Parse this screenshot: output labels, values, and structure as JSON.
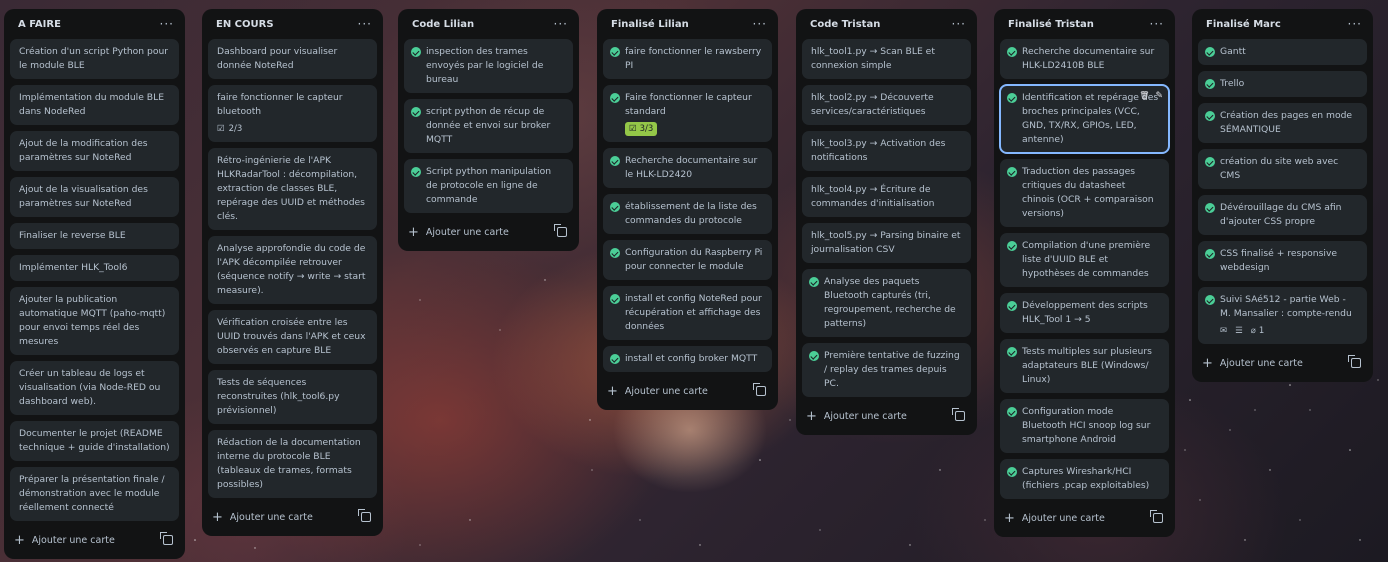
{
  "lists": [
    {
      "title": "A FAIRE",
      "add_label": "Ajouter une carte",
      "cards": [
        {
          "text": "Création d'un script Python pour le module BLE"
        },
        {
          "text": "Implémentation du module BLE dans NodeRed"
        },
        {
          "text": "Ajout de la modification des paramètres sur NoteRed"
        },
        {
          "text": "Ajout de la visualisation des paramètres sur NoteRed"
        },
        {
          "text": "Finaliser le reverse BLE"
        },
        {
          "text": "Implémenter HLK_Tool6"
        },
        {
          "text": "Ajouter la publication automatique MQTT (paho-mqtt) pour envoi temps réel des mesures"
        },
        {
          "text": "Créer un tableau de logs et visualisation (via Node-RED ou dashboard web)."
        },
        {
          "text": "Documenter le projet (README technique + guide d'installation)"
        },
        {
          "text": "Préparer la présentation finale / démonstration avec le module réellement connecté"
        }
      ]
    },
    {
      "title": "EN COURS",
      "add_label": "Ajouter une carte",
      "cards": [
        {
          "text": "Dashboard pour visualiser donnée NoteRed"
        },
        {
          "text": "faire fonctionner le capteur bluetooth",
          "checklist": "2/3"
        },
        {
          "text": "Rétro-ingénierie de l'APK HLKRadarTool : décompilation, extraction de classes BLE, repérage des UUID et méthodes clés."
        },
        {
          "text": "Analyse approfondie du code de l'APK décompilée retrouver (séquence notify → write → start measure)."
        },
        {
          "text": "Vérification croisée entre les UUID trouvés dans l'APK et ceux observés en capture BLE"
        },
        {
          "text": "Tests de séquences reconstruites (hlk_tool6.py prévisionnel)"
        },
        {
          "text": "Rédaction de la documentation interne du protocole BLE (tableaux de trames, formats possibles)"
        }
      ]
    },
    {
      "title": "Code Lilian",
      "add_label": "Ajouter une carte",
      "cards": [
        {
          "text": "inspection des trames envoyés par le logiciel de bureau",
          "done": true
        },
        {
          "text": "script python de récup de donnée et envoi sur broker MQTT",
          "done": true
        },
        {
          "text": "Script python manipulation de protocole en ligne de commande",
          "done": true
        }
      ]
    },
    {
      "title": "Finalisé Lilian",
      "add_label": "Ajouter une carte",
      "cards": [
        {
          "text": "faire fonctionner le rawsberry PI",
          "done": true
        },
        {
          "text": "Faire fonctionner le capteur standard",
          "done": true,
          "checklist_green": "3/3"
        },
        {
          "text": "Recherche documentaire sur le HLK-LD2420",
          "done": true
        },
        {
          "text": "établissement de la liste des commandes du protocole",
          "done": true
        },
        {
          "text": "Configuration du Raspberry Pi pour connecter le module",
          "done": true
        },
        {
          "text": "install et config NoteRed pour récupération et affichage des données",
          "done": true
        },
        {
          "text": "install et config broker MQTT",
          "done": true
        }
      ]
    },
    {
      "title": "Code Tristan",
      "add_label": "Ajouter une carte",
      "cards": [
        {
          "text": "hlk_tool1.py → Scan BLE et connexion simple"
        },
        {
          "text": "hlk_tool2.py → Découverte services/caractéristiques"
        },
        {
          "text": "hlk_tool3.py → Activation des notifications"
        },
        {
          "text": "hlk_tool4.py → Écriture de commandes d'initialisation"
        },
        {
          "text": "hlk_tool5.py → Parsing binaire et journalisation CSV"
        },
        {
          "text": "Analyse des paquets Bluetooth capturés (tri, regroupement, recherche de patterns)",
          "done": true
        },
        {
          "text": "Première tentative de fuzzing / replay des trames depuis PC.",
          "done": true
        }
      ]
    },
    {
      "title": "Finalisé Tristan",
      "add_label": "Ajouter une carte",
      "cards": [
        {
          "text": "Recherche documentaire sur HLK-LD2410B BLE",
          "done": true
        },
        {
          "text": "Identification et repérage des broches principales (VCC, GND, TX/RX, GPIOs, LED, antenne)",
          "done": true,
          "selected": true
        },
        {
          "text": "Traduction des passages critiques du datasheet chinois (OCR + comparaison versions)",
          "done": true
        },
        {
          "text": "Compilation d'une première liste d'UUID BLE et hypothèses de commandes",
          "done": true
        },
        {
          "text": "Développement des scripts HLK_Tool 1 → 5",
          "done": true
        },
        {
          "text": "Tests multiples sur plusieurs adaptateurs BLE (Windows/ Linux)",
          "done": true
        },
        {
          "text": "Configuration mode Bluetooth HCI snoop log sur smartphone Android",
          "done": true
        },
        {
          "text": "Captures Wireshark/HCI (fichiers .pcap exploitables)",
          "done": true
        }
      ]
    },
    {
      "title": "Finalisé Marc",
      "add_label": "Ajouter une carte",
      "cards": [
        {
          "text": "Gantt",
          "done": true
        },
        {
          "text": "Trello",
          "done": true
        },
        {
          "text": "Création des pages en mode SÉMANTIQUE",
          "done": true
        },
        {
          "text": "création du site web avec CMS",
          "done": true
        },
        {
          "text": "Dévérouillage du CMS afin d'ajouter CSS propre",
          "done": true
        },
        {
          "text": "CSS finalisé + responsive webdesign",
          "done": true
        },
        {
          "text": "Suivi SAé512 - partie Web - M. Mansalier : compte-rendu",
          "done": true,
          "attachments": "1"
        }
      ]
    }
  ],
  "colors": {
    "list_bg": "#121314",
    "card_bg": "#22272b",
    "done_green": "#4bce97",
    "selected_outline": "#85b8ff"
  }
}
